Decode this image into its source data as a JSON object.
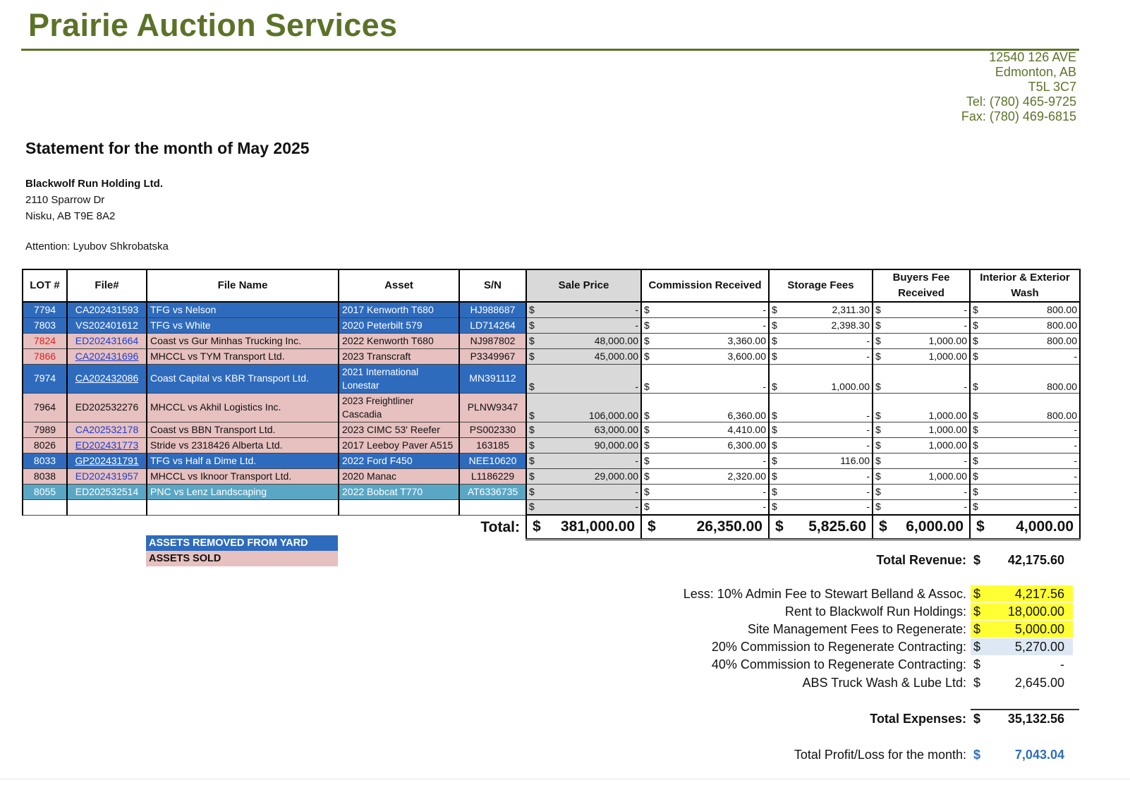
{
  "header": {
    "company": "Prairie Auction Services",
    "address": [
      "12540 126 AVE",
      "Edmonton, AB",
      "T5L 3C7",
      "Tel: (780) 465-9725",
      "Fax: (780) 469-6815"
    ]
  },
  "statement_title": "Statement for the month of May 2025",
  "client": {
    "name": "Blackwolf Run Holding Ltd.",
    "street": "2110 Sparrow Dr",
    "city": "Nisku, AB  T9E 8A2"
  },
  "attention": "Attention:  Lyubov Shkrobatska",
  "table": {
    "headers": [
      "LOT #",
      "File#",
      "File Name",
      "Asset",
      "S/N",
      "Sale Price",
      "Commission Received",
      "Storage Fees",
      "Buyers Fee Received",
      "Interior & Exterior Wash"
    ],
    "currency": "$",
    "rows": [
      {
        "lot": "7794",
        "file": "CA202431593",
        "name": "TFG vs Nelson",
        "asset": "2017 Kenworth T680",
        "sn": "HJ988687",
        "sale": "-",
        "comm": "-",
        "storage": "2,311.30",
        "buyers": "-",
        "wash": "800.00"
      },
      {
        "lot": "7803",
        "file": "VS202401612",
        "name": "TFG vs White",
        "asset": "2020 Peterbilt 579",
        "sn": "LD714264",
        "sale": "-",
        "comm": "-",
        "storage": "2,398.30",
        "buyers": "-",
        "wash": "800.00"
      },
      {
        "lot": "7824",
        "file": "ED202431664",
        "name": "Coast vs Gur Minhas Trucking Inc.",
        "asset": "2022 Kenworth T680",
        "sn": "NJ987802",
        "sale": "48,000.00",
        "comm": "3,360.00",
        "storage": "-",
        "buyers": "1,000.00",
        "wash": "800.00"
      },
      {
        "lot": "7866",
        "file": "CA202431696",
        "name": "MHCCL vs TYM Transport Ltd.",
        "asset": " 2023 Transcraft",
        "sn": "P3349967",
        "sale": "45,000.00",
        "comm": "3,600.00",
        "storage": "-",
        "buyers": "1,000.00",
        "wash": "-"
      },
      {
        "lot": "7974",
        "file": "CA202432086",
        "name": "Coast Capital vs KBR Transport Ltd.",
        "asset": "2021 International Lonestar",
        "sn": "MN391112",
        "sale": "-",
        "comm": "-",
        "storage": "1,000.00",
        "buyers": "-",
        "wash": "800.00"
      },
      {
        "lot": "7964",
        "file": "ED202532276",
        "name": "MHCCL vs Akhil Logistics Inc.",
        "asset": "2023 Freightliner Cascadia",
        "sn": "PLNW9347",
        "sale": "106,000.00",
        "comm": "6,360.00",
        "storage": "-",
        "buyers": "1,000.00",
        "wash": "800.00"
      },
      {
        "lot": "7989",
        "file": "CA202532178",
        "name": "Coast vs BBN Transport Ltd.",
        "asset": "2023 CIMC 53' Reefer",
        "sn": "PS002330",
        "sale": "63,000.00",
        "comm": "4,410.00",
        "storage": "-",
        "buyers": "1,000.00",
        "wash": "-"
      },
      {
        "lot": "8026",
        "file": "ED202431773",
        "name": "Stride vs 2318426 Alberta Ltd.",
        "asset": "2017 Leeboy Paver A515",
        "sn": "163185",
        "sale": "90,000.00",
        "comm": "6,300.00",
        "storage": "-",
        "buyers": "1,000.00",
        "wash": "-"
      },
      {
        "lot": "8033",
        "file": "GP202431791",
        "name": "TFG vs Half a Dime Ltd.",
        "asset": "2022 Ford F450",
        "sn": "NEE10620",
        "sale": "-",
        "comm": "-",
        "storage": "116.00",
        "buyers": "-",
        "wash": "-"
      },
      {
        "lot": "8038",
        "file": "ED202431957",
        "name": "MHCCL vs Iknoor Transport Ltd.",
        "asset": "2020 Manac",
        "sn": "L1186229",
        "sale": "29,000.00",
        "comm": "2,320.00",
        "storage": "-",
        "buyers": "1,000.00",
        "wash": "-"
      },
      {
        "lot": "8055",
        "file": "ED202532514",
        "name": "PNC vs Lenz Landscaping",
        "asset": "2022 Bobcat T770",
        "sn": "AT6336735",
        "sale": "-",
        "comm": "-",
        "storage": "-",
        "buyers": "-",
        "wash": "-"
      },
      {
        "lot": "",
        "file": "",
        "name": "",
        "asset": "",
        "sn": "",
        "sale": "-",
        "comm": "-",
        "storage": "-",
        "buyers": "-",
        "wash": "-"
      }
    ],
    "total_label": "Total:",
    "totals": {
      "sale": "381,000.00",
      "comm": "26,350.00",
      "storage": "5,825.60",
      "buyers": "6,000.00",
      "wash": "4,000.00"
    }
  },
  "legend": {
    "removed": "ASSETS REMOVED FROM YARD",
    "sold": "ASSETS SOLD"
  },
  "summary": {
    "total_revenue": {
      "label": "Total Revenue:",
      "value": "42,175.60"
    },
    "expenses": [
      {
        "label": "Less: 10% Admin Fee to Stewart Belland & Assoc.",
        "value": "4,217.56"
      },
      {
        "label": "Rent to Blackwolf Run Holdings:",
        "value": "18,000.00"
      },
      {
        "label": "Site Management Fees to Regenerate:",
        "value": "5,000.00"
      },
      {
        "label": "20% Commission to Regenerate Contracting:",
        "value": "5,270.00"
      },
      {
        "label": "40% Commission to Regenerate Contracting:",
        "value": "-"
      },
      {
        "label": "ABS Truck Wash & Lube Ltd:",
        "value": "2,645.00"
      }
    ],
    "total_expenses": {
      "label": "Total Expenses:",
      "value": "35,132.56"
    },
    "profit": {
      "label": "Total Profit/Loss for the month:",
      "value": "7,043.04"
    }
  },
  "colors": {
    "brand_green": "#5b7328",
    "removed_blue": "#2e6bbd",
    "sold_pink": "#e7c0c0",
    "teal": "#5aa7c5",
    "highlight_yellow": "#ffff33",
    "profit_blue": "#2f6fb8"
  }
}
